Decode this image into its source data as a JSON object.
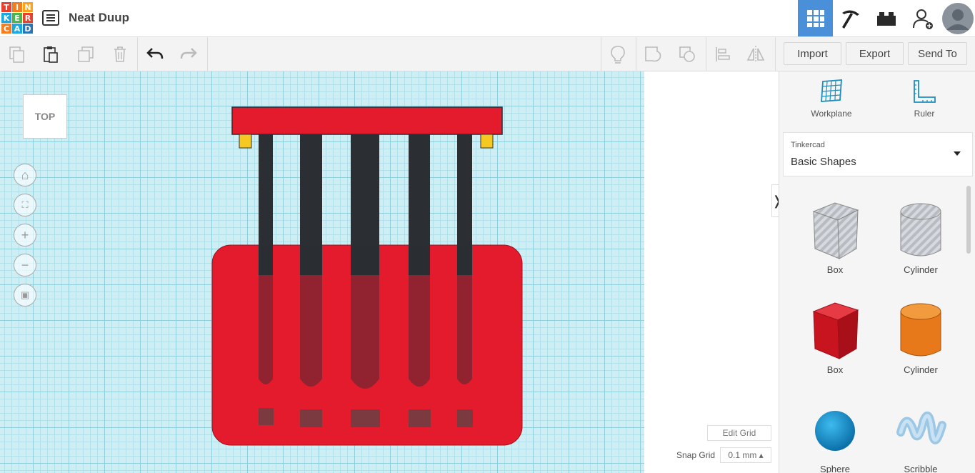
{
  "logo": {
    "letters": [
      "T",
      "I",
      "N",
      "K",
      "E",
      "R",
      "C",
      "A",
      "D"
    ],
    "colors": [
      "#e8412f",
      "#f47d20",
      "#ffa41a",
      "#1aa8e0",
      "#4ab74e",
      "#e8412f",
      "#f47d20",
      "#1aa8e0",
      "#2b75b6"
    ]
  },
  "app": {
    "title": "Neat Duup"
  },
  "topbar": {
    "icons": [
      "grid-view-icon",
      "pickaxe-icon",
      "bricks-icon",
      "add-user-icon",
      "avatar"
    ],
    "active_color": "#4a90d9"
  },
  "toolbar": {
    "import_label": "Import",
    "export_label": "Export",
    "send_to_label": "Send To"
  },
  "canvas": {
    "view_label": "TOP",
    "edit_grid_label": "Edit Grid",
    "snap_grid_label": "Snap Grid",
    "snap_grid_value": "0.1 mm ▴",
    "collapse_glyph": "❭"
  },
  "panel": {
    "workplane_label": "Workplane",
    "ruler_label": "Ruler",
    "category": "Tinkercad",
    "library": "Basic Shapes",
    "shapes": [
      {
        "label": "Box",
        "kind": "hole-box"
      },
      {
        "label": "Cylinder",
        "kind": "hole-cylinder"
      },
      {
        "label": "Box",
        "kind": "box"
      },
      {
        "label": "Cylinder",
        "kind": "cylinder"
      },
      {
        "label": "Sphere",
        "kind": "sphere"
      },
      {
        "label": "Scribble",
        "kind": "scribble"
      }
    ]
  },
  "colors": {
    "red": "#e31b2c",
    "dark": "#2b2f33",
    "yellow": "#f5c922",
    "orange": "#e8791a",
    "blue": "#1c9ad6"
  }
}
